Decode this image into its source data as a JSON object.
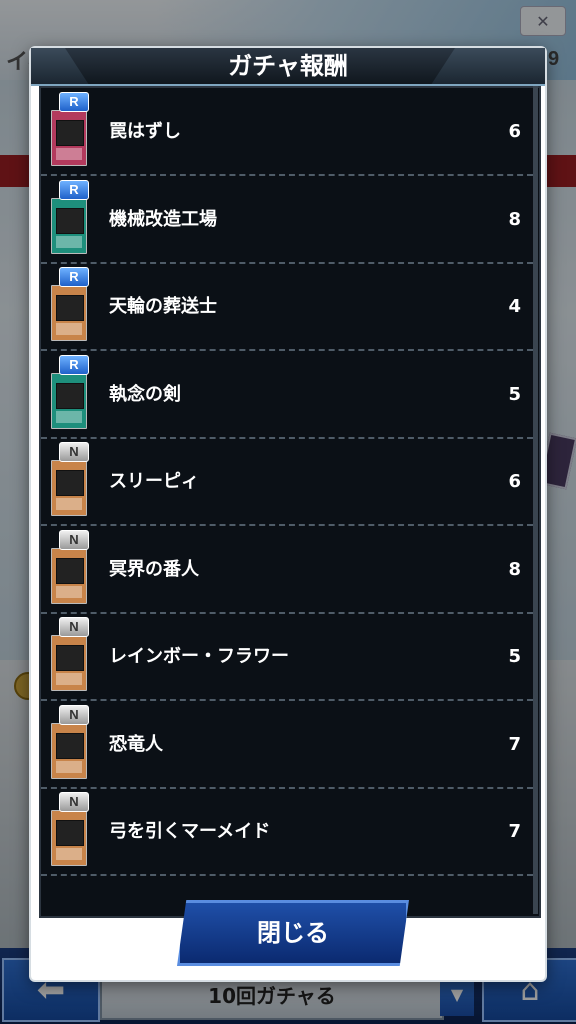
{
  "background": {
    "event_label": "イベ",
    "count_right": "9",
    "gacha10_label": "10回ガチャる"
  },
  "dialog": {
    "title": "ガチャ報酬",
    "close_label": "閉じる",
    "items": [
      {
        "rarity": "R",
        "name": "罠はずし",
        "count": "6",
        "card_color": "#b33a5d"
      },
      {
        "rarity": "R",
        "name": "機械改造工場",
        "count": "8",
        "card_color": "#1e8f7c"
      },
      {
        "rarity": "R",
        "name": "天輪の葬送士",
        "count": "4",
        "card_color": "#c8844a"
      },
      {
        "rarity": "R",
        "name": "執念の剣",
        "count": "5",
        "card_color": "#1e8f7c"
      },
      {
        "rarity": "N",
        "name": "スリーピィ",
        "count": "6",
        "card_color": "#c8844a"
      },
      {
        "rarity": "N",
        "name": "冥界の番人",
        "count": "8",
        "card_color": "#c8844a"
      },
      {
        "rarity": "N",
        "name": "レインボー・フラワー",
        "count": "5",
        "card_color": "#c8844a"
      },
      {
        "rarity": "N",
        "name": "恐竜人",
        "count": "7",
        "card_color": "#c8844a"
      },
      {
        "rarity": "N",
        "name": "弓を引くマーメイド",
        "count": "7",
        "card_color": "#c8844a"
      }
    ]
  }
}
